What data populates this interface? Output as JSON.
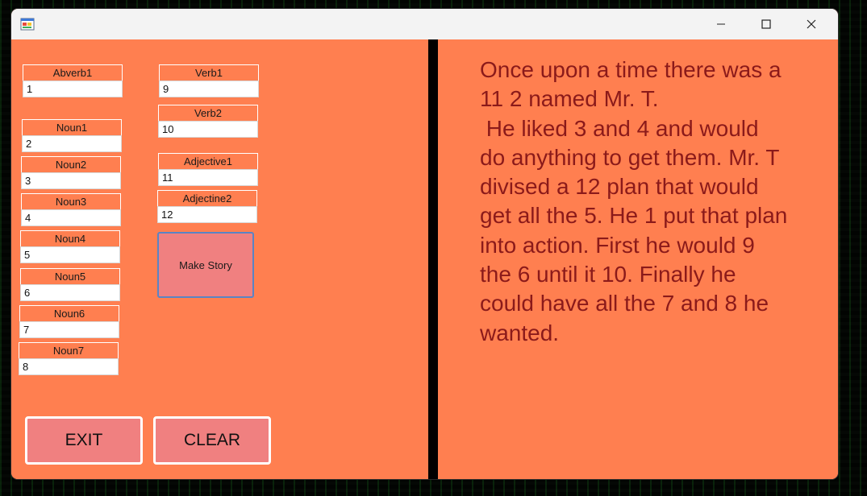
{
  "colors": {
    "window_bg": "#ff7f50",
    "titlebar_bg": "#f3f3f3",
    "divider": "#000000",
    "button_bg": "#f08080",
    "story_text": "#8b1a1a"
  },
  "titlebar": {
    "icon": "app-form-icon",
    "controls": [
      "minimize-icon",
      "maximize-icon",
      "close-icon"
    ]
  },
  "fields": {
    "adverb1": {
      "label": "Abverb1",
      "value": "1"
    },
    "noun1": {
      "label": "Noun1",
      "value": "2"
    },
    "noun2": {
      "label": "Noun2",
      "value": "3"
    },
    "noun3": {
      "label": "Noun3",
      "value": "4"
    },
    "noun4": {
      "label": "Noun4",
      "value": "5"
    },
    "noun5": {
      "label": "Noun5",
      "value": "6"
    },
    "noun6": {
      "label": "Noun6",
      "value": "7"
    },
    "noun7": {
      "label": "Noun7",
      "value": "8"
    },
    "verb1": {
      "label": "Verb1",
      "value": "9"
    },
    "verb2": {
      "label": "Verb2",
      "value": "10"
    },
    "adjective1": {
      "label": "Adjective1",
      "value": "11"
    },
    "adjective2": {
      "label": "Adjectine2",
      "value": "12"
    }
  },
  "buttons": {
    "make_story": "Make Story",
    "exit": "EXIT",
    "clear": "CLEAR"
  },
  "story": {
    "text": "Once upon a time there was a\n11 2 named Mr. T.\n He liked 3 and 4 and would\ndo anything to get them. Mr. T\ndivised a 12 plan that would\nget all the 5. He 1 put that plan\ninto action. First he would 9\nthe 6 until it 10. Finally he\ncould have all the 7 and 8 he\nwanted."
  }
}
